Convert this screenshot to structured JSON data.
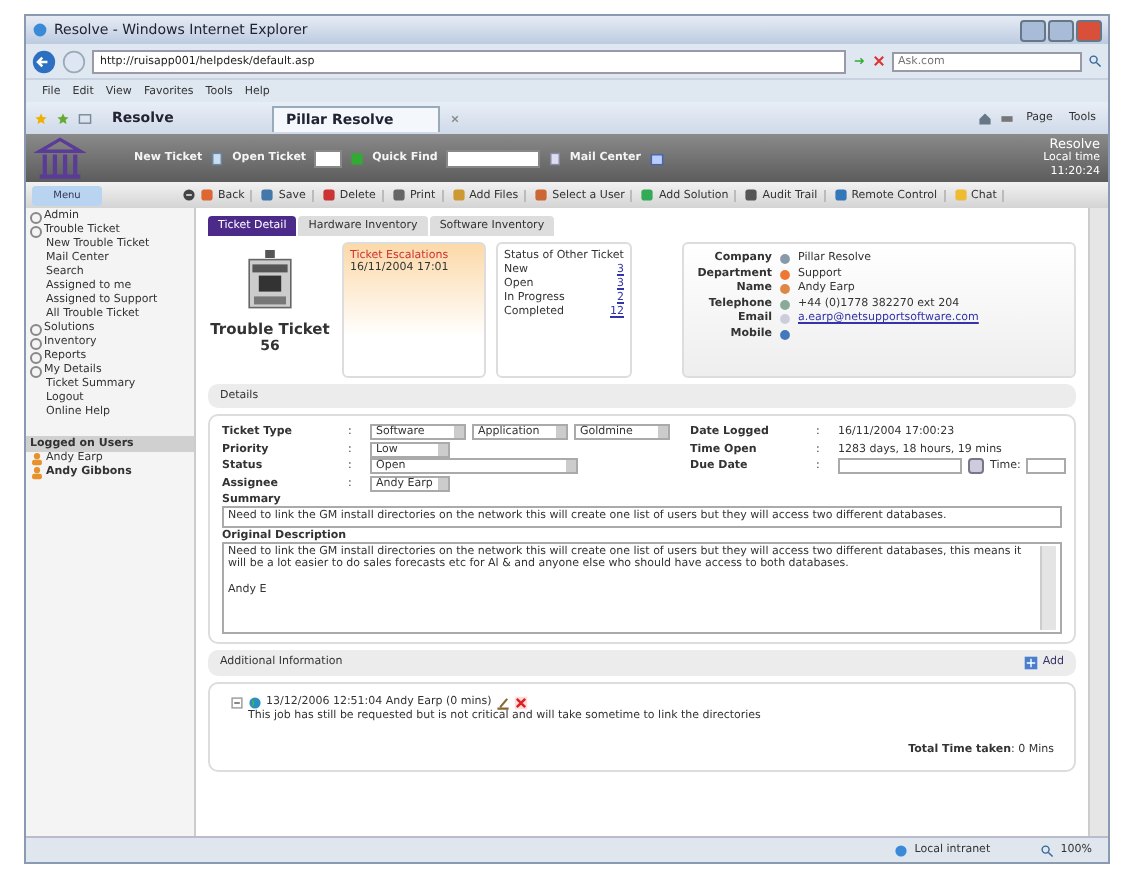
{
  "window": {
    "title": "Resolve - Windows Internet Explorer"
  },
  "address_bar": {
    "url": "http://ruisapp001/helpdesk/default.asp",
    "search_placeholder": "Ask.com"
  },
  "menu_bar": [
    "File",
    "Edit",
    "View",
    "Favorites",
    "Tools",
    "Help"
  ],
  "browser_tabs": [
    {
      "label": "Resolve",
      "selected": false
    },
    {
      "label": "Pillar Resolve",
      "selected": true
    }
  ],
  "command_bar": [
    "Page",
    "Tools"
  ],
  "app_header": {
    "new_ticket": "New Ticket",
    "open_ticket": "Open Ticket",
    "quick_find": "Quick Find",
    "mail_center": "Mail Center",
    "brand": "Resolve",
    "local_time_label": "Local time",
    "local_time": "11:20:24"
  },
  "toolbar": [
    "Back",
    "Save",
    "Delete",
    "Print",
    "Add Files",
    "Select a User",
    "Add Solution",
    "Audit Trail",
    "Remote Control",
    "Chat"
  ],
  "sidebar": {
    "menu_button": "Menu",
    "items": [
      {
        "label": "Admin"
      },
      {
        "label": "Trouble Ticket",
        "children": [
          "New Trouble Ticket",
          "Mail Center",
          "Search",
          "Assigned to me",
          "Assigned to Support",
          "All Trouble Ticket"
        ]
      },
      {
        "label": "Solutions"
      },
      {
        "label": "Inventory"
      },
      {
        "label": "Reports"
      },
      {
        "label": "My Details",
        "children": [
          "Ticket Summary",
          "Logout",
          "Online Help"
        ]
      }
    ]
  },
  "logged_on": {
    "title": "Logged on Users",
    "users": [
      {
        "name": "Andy Earp",
        "current": false
      },
      {
        "name": "Andy Gibbons",
        "current": true
      }
    ]
  },
  "ticket_tabs": [
    {
      "label": "Ticket Detail",
      "selected": true
    },
    {
      "label": "Hardware Inventory",
      "selected": false
    },
    {
      "label": "Software Inventory",
      "selected": false
    }
  ],
  "ticket": {
    "title": "Trouble Ticket",
    "number": "56"
  },
  "escalations": {
    "title": "Ticket Escalations",
    "date": "16/11/2004 17:01"
  },
  "status_other": {
    "title": "Status of Other Ticket",
    "rows": [
      {
        "label": "New",
        "count": "3"
      },
      {
        "label": "Open",
        "count": "3"
      },
      {
        "label": "In Progress",
        "count": "2"
      },
      {
        "label": "Completed",
        "count": "12"
      }
    ]
  },
  "contact": [
    {
      "label": "Company",
      "value": "Pillar Resolve",
      "kind": "text"
    },
    {
      "label": "Department",
      "value": "Support",
      "kind": "text"
    },
    {
      "label": "Name",
      "value": "Andy Earp",
      "kind": "text"
    },
    {
      "label": "Telephone",
      "value": "+44 (0)1778 382270 ext 204",
      "kind": "text"
    },
    {
      "label": "Email",
      "value": "a.earp@netsupportsoftware.com",
      "kind": "link"
    },
    {
      "label": "Mobile"
    }
  ],
  "details": {
    "title": "Details",
    "left": [
      {
        "label": "Ticket Type",
        "sep": ":",
        "selects": [
          "Software",
          "Application",
          "Goldmine"
        ]
      },
      {
        "label": "Priority",
        "sep": ":",
        "selects": [
          "Low"
        ]
      },
      {
        "label": "Status",
        "sep": ":",
        "selects": [
          "Open"
        ]
      },
      {
        "label": "Assignee",
        "sep": ":",
        "selects": [
          "Andy Earp"
        ]
      }
    ],
    "right": [
      {
        "label": "Date Logged",
        "sep": ":",
        "value": "16/11/2004 17:00:23",
        "kind": "text"
      },
      {
        "label": "Time Open",
        "sep": ":",
        "value": "1283 days, 18 hours, 19 mins",
        "kind": "text"
      },
      {
        "label": "Due Date",
        "sep": ":",
        "kind": "date",
        "time_label": "Time:"
      }
    ],
    "summary": {
      "label": "Summary",
      "value": "Need to link the GM install directories on the network this will create one list of users but they will access two different databases."
    },
    "description": {
      "label": "Original Description",
      "value": "Need to link the GM install directories on the network this will create one list of users but they will access two different databases, this means it will be a lot easier to do sales forecasts etc for Al & and anyone else who should have access to both databases.",
      "signature": "Andy E"
    }
  },
  "additional": {
    "title": "Additional Information",
    "add": "Add",
    "entries": [
      {
        "header": "13/12/2006 12:51:04 Andy Earp (0 mins)",
        "text": "This job has still be requested but is not critical and will take sometime to link the directories"
      }
    ],
    "total_label": "Total Time taken",
    "total": ": 0 Mins"
  },
  "status_bar": {
    "zone": "Local intranet",
    "zoom": "100%"
  }
}
